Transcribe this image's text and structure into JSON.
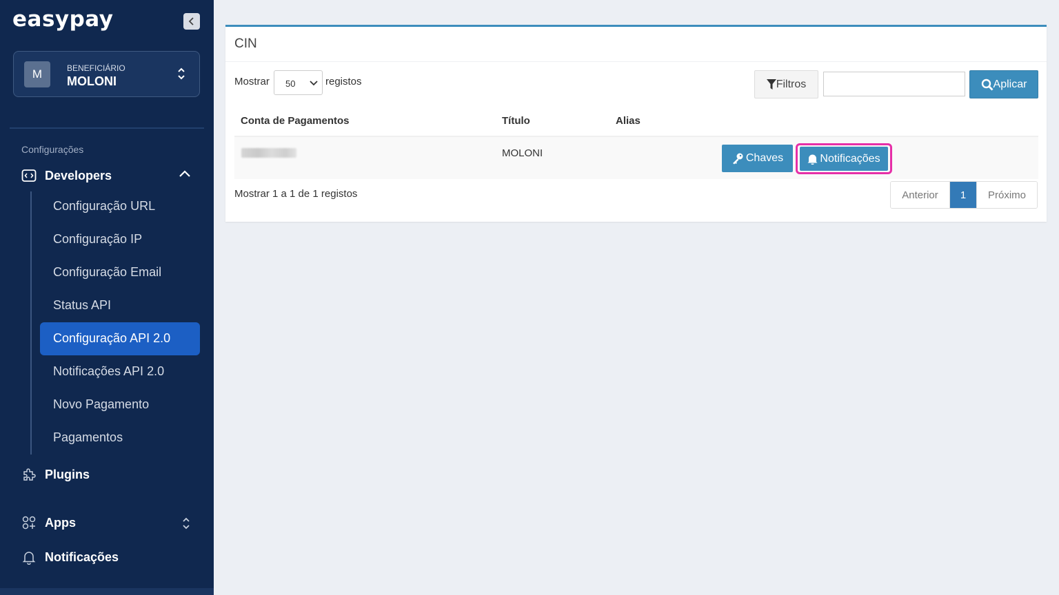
{
  "sidebar": {
    "logo": "easypay",
    "beneficiary": {
      "avatar_letter": "M",
      "label": "BENEFICIÁRIO",
      "name": "MOLONI"
    },
    "section_label": "Configurações",
    "developers": {
      "label": "Developers",
      "items": [
        {
          "label": "Configuração URL"
        },
        {
          "label": "Configuração IP"
        },
        {
          "label": "Configuração Email"
        },
        {
          "label": "Status API"
        },
        {
          "label": "Configuração API 2.0",
          "active": true
        },
        {
          "label": "Notificações API 2.0"
        },
        {
          "label": "Novo Pagamento"
        },
        {
          "label": "Pagamentos"
        }
      ]
    },
    "plugins_label": "Plugins",
    "apps_label": "Apps",
    "notifications_label": "Notificações"
  },
  "panel": {
    "title": "CIN",
    "show_label": "Mostrar",
    "page_size": "50",
    "records_label": "registos",
    "filters_label": "Filtros",
    "search": {
      "value": "",
      "placeholder": ""
    },
    "apply_label": "Aplicar",
    "columns": [
      "Conta de Pagamentos",
      "Título",
      "Alias"
    ],
    "rows": [
      {
        "account": "",
        "title": "MOLONI",
        "alias": ""
      }
    ],
    "keys_button": "Chaves",
    "notifications_button": "Notificações",
    "info": "Mostrar 1 a 1 de 1 registos",
    "pagination": {
      "prev": "Anterior",
      "current": "1",
      "next": "Próximo"
    }
  },
  "colors": {
    "sidebar_bg": "#10284f",
    "active_item": "#1c5fc4",
    "primary_button": "#3c8dbc",
    "highlight_border": "#e62fa8"
  }
}
